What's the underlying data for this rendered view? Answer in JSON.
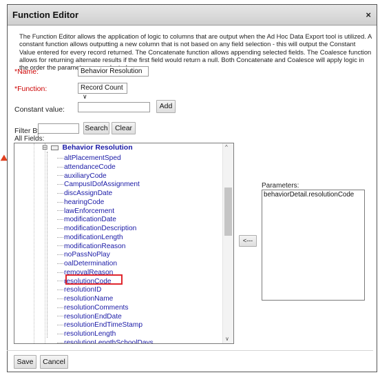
{
  "dialog": {
    "title": "Function Editor",
    "close_glyph": "×",
    "description": "The Function Editor allows the application of logic to columns that are output when the Ad Hoc Data Export tool is utilized. A constant function allows outputting a new column that is not based on any field selection - this will output the Constant Value entered for every record returned. The Concatenate function allows appending selected fields. The Coalesce function allows for returning alternate results if the first field would return a null. Both Concatenate and Coalesce will apply logic in the order the parameters are selected."
  },
  "form": {
    "name_required_mark": "*",
    "name_label": "Name:",
    "name_value": "Behavior Resolution",
    "function_required_mark": "*",
    "function_label": "Function:",
    "function_value": "Record Count",
    "function_caret": "∨",
    "constant_label": "Constant value:",
    "constant_value": "",
    "add_label": "Add"
  },
  "filter": {
    "label": "Filter By",
    "value": "",
    "search_label": "Search",
    "clear_label": "Clear",
    "all_fields_label": "All Fields:"
  },
  "tree": {
    "collapse_glyph": "⊟",
    "node_label": "Behavior Resolution",
    "scroll_up": "^",
    "scroll_down": "∨",
    "items": [
      "altPlacementSped",
      "attendanceCode",
      "auxiliaryCode",
      "CampusIDofAssignment",
      "discAssignDate",
      "hearingCode",
      "lawEnforcement",
      "modificationDate",
      "modificationDescription",
      "modificationLength",
      "modificationReason",
      "noPassNoPlay",
      "oalDetermination",
      "removalReason",
      "resolutionCode",
      "resolutionID",
      "resolutionName",
      "resolutionComments",
      "resolutionEndDate",
      "resolutionEndTimeStamp",
      "resolutionLength",
      "resolutionLengthSchoolDays"
    ]
  },
  "parameters": {
    "label": "Parameters:",
    "items": [
      "behaviorDetail.resolutionCode"
    ],
    "move_label": "<---"
  },
  "footer": {
    "save_label": "Save",
    "cancel_label": "Cancel"
  }
}
